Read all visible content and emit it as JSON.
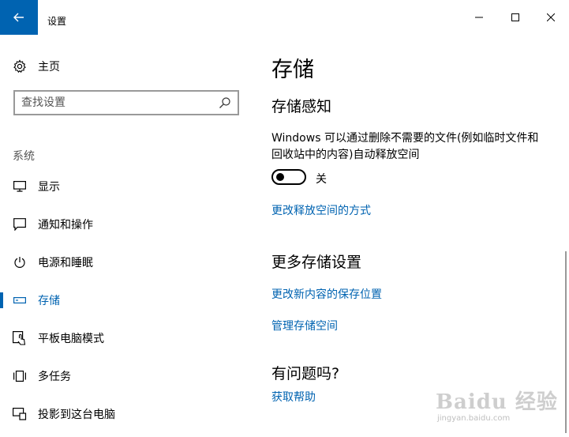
{
  "window": {
    "title": "设置"
  },
  "sidebar": {
    "home_label": "主页",
    "search_placeholder": "查找设置",
    "section_label": "系统",
    "items": [
      {
        "label": "显示",
        "icon": "monitor-icon"
      },
      {
        "label": "通知和操作",
        "icon": "notification-icon"
      },
      {
        "label": "电源和睡眠",
        "icon": "power-icon"
      },
      {
        "label": "存储",
        "icon": "storage-icon",
        "active": true
      },
      {
        "label": "平板电脑模式",
        "icon": "tablet-mode-icon"
      },
      {
        "label": "多任务",
        "icon": "multitasking-icon"
      },
      {
        "label": "投影到这台电脑",
        "icon": "project-icon"
      }
    ]
  },
  "main": {
    "page_title": "存储",
    "storage_sense": {
      "heading": "存储感知",
      "description": "Windows 可以通过删除不需要的文件(例如临时文件和回收站中的内容)自动释放空间",
      "toggle_state": "关",
      "toggle_on": false,
      "link": "更改释放空间的方式"
    },
    "more_settings": {
      "heading": "更多存储设置",
      "links": [
        "更改新内容的保存位置",
        "管理存储空间"
      ]
    },
    "help": {
      "heading": "有问题吗?",
      "link": "获取帮助"
    }
  },
  "watermark": {
    "logo": "Baidu 经验",
    "url": "jingyan.baidu.com"
  },
  "colors": {
    "accent": "#0063b1",
    "text": "#000000",
    "muted": "#555555"
  }
}
